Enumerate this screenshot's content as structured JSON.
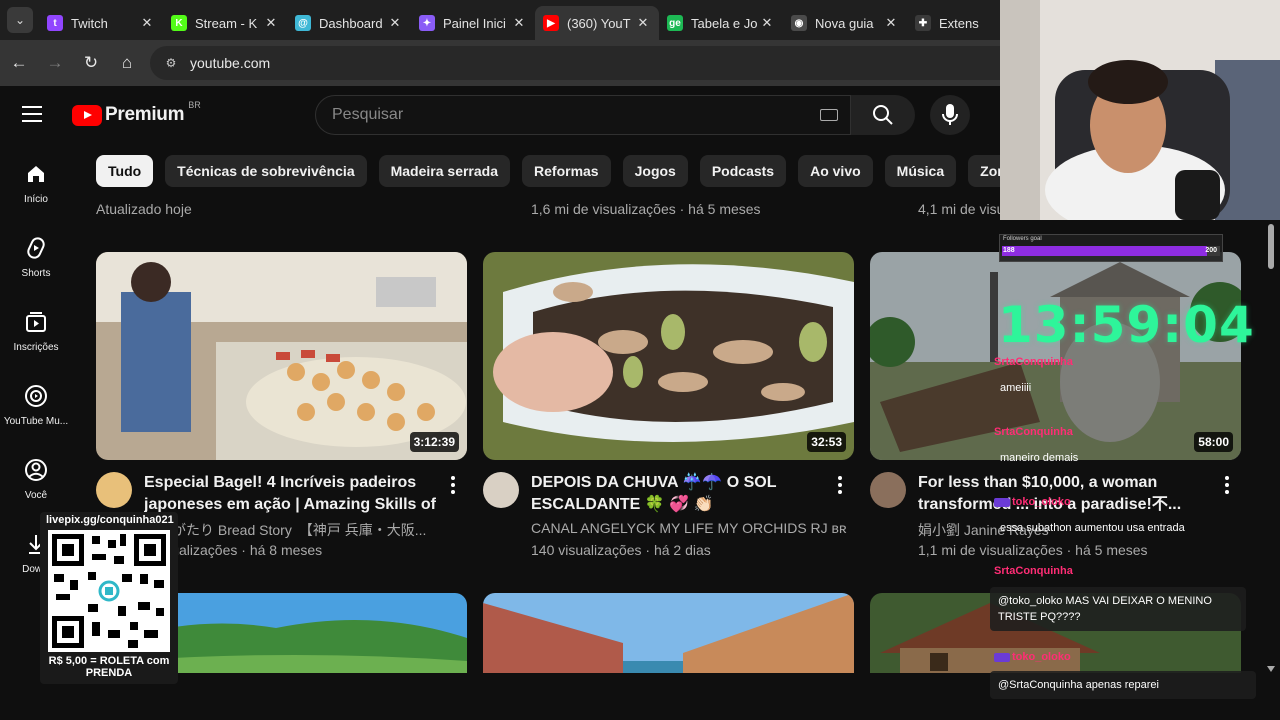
{
  "browser": {
    "tabs": [
      {
        "label": "Twitch",
        "color": "#9146ff",
        "glyph": "t",
        "active": false
      },
      {
        "label": "Stream - K",
        "color": "#53fc18",
        "glyph": "K",
        "active": false
      },
      {
        "label": "Dashboard",
        "color": "#3fb8d6",
        "glyph": "@",
        "active": false
      },
      {
        "label": "Painel Inici",
        "color": "#8a5cf6",
        "glyph": "✦",
        "active": false
      },
      {
        "label": "(360) YouT",
        "color": "#ff0000",
        "glyph": "▶",
        "active": true
      },
      {
        "label": "Tabela e Jo",
        "color": "#1db954",
        "glyph": "ge",
        "active": false
      },
      {
        "label": "Nova guia",
        "color": "#4a4a4a",
        "glyph": "◉",
        "active": false
      },
      {
        "label": "Extens",
        "color": "#3a3a3a",
        "glyph": "✚",
        "active": false
      }
    ],
    "url": "youtube.com"
  },
  "youtube": {
    "logo_text": "Premium",
    "region": "BR",
    "search_placeholder": "Pesquisar",
    "sidebar": [
      {
        "label": "Início",
        "icon": "home-icon"
      },
      {
        "label": "Shorts",
        "icon": "shorts-icon"
      },
      {
        "label": "Inscrições",
        "icon": "subscriptions-icon"
      },
      {
        "label": "YouTube Mu...",
        "icon": "youtube-music-icon"
      },
      {
        "label": "Você",
        "icon": "you-icon"
      },
      {
        "label": "Downl",
        "icon": "download-icon"
      }
    ],
    "chips": [
      "Tudo",
      "Técnicas de sobrevivência",
      "Madeira serrada",
      "Reformas",
      "Jogos",
      "Podcasts",
      "Ao vivo",
      "Música",
      "Zonas ru"
    ],
    "prev_row_meta": [
      "Atualizado hoje",
      "1,6 mi de visualizações · há 5 meses",
      "4,1 mi de visu"
    ],
    "videos": [
      {
        "title": "Especial Bagel! 4 Incríveis padeiros japoneses em ação | Amazing Skills of ...",
        "channel": "ものがたり Bread Story　【神戸 兵庫・大阪...",
        "stats": "il visualizações · há 8 meses",
        "duration": "3:12:39"
      },
      {
        "title": "DEPOIS DA CHUVA ☔☂️ O SOL ESCALDANTE 🍀 💞 👏🏻",
        "channel": "CANAL ANGELYCK MY LIFE MY ORCHIDS RJ ʙʀ",
        "stats": "140 visualizações · há 2 dias",
        "duration": "32:53"
      },
      {
        "title": "For less than $10,000, a woman transformed ... into a paradise!不...",
        "channel": "娟小劉 Janine Rayes",
        "stats": "1,1 mi de visualizações · há 5 meses",
        "duration": "58:00"
      }
    ]
  },
  "overlay": {
    "goal": {
      "label": "Followers goal",
      "current": "188",
      "max": "200",
      "fraction": 0.94
    },
    "timer": "13:59:04",
    "chat": [
      {
        "user": "SrtaConquinha",
        "text": "ameiiii",
        "badge": false
      },
      {
        "user": "SrtaConquinha",
        "text": "maneiro demais",
        "badge": false
      },
      {
        "user": "toko_oloko",
        "text": "essa subathon aumentou usa entrada",
        "badge": true
      },
      {
        "user": "SrtaConquinha",
        "text": "@toko_oloko MAS VAI DEIXAR O MENINO TRISTE PQ????",
        "badge": false
      },
      {
        "user": "toko_oloko",
        "text": "@SrtaConquinha apenas reparei",
        "badge": true
      }
    ],
    "livepix_url": "livepix.gg/conquinha021",
    "livepix_caption": "R$ 5,00 = ROLETA com PRENDA"
  }
}
